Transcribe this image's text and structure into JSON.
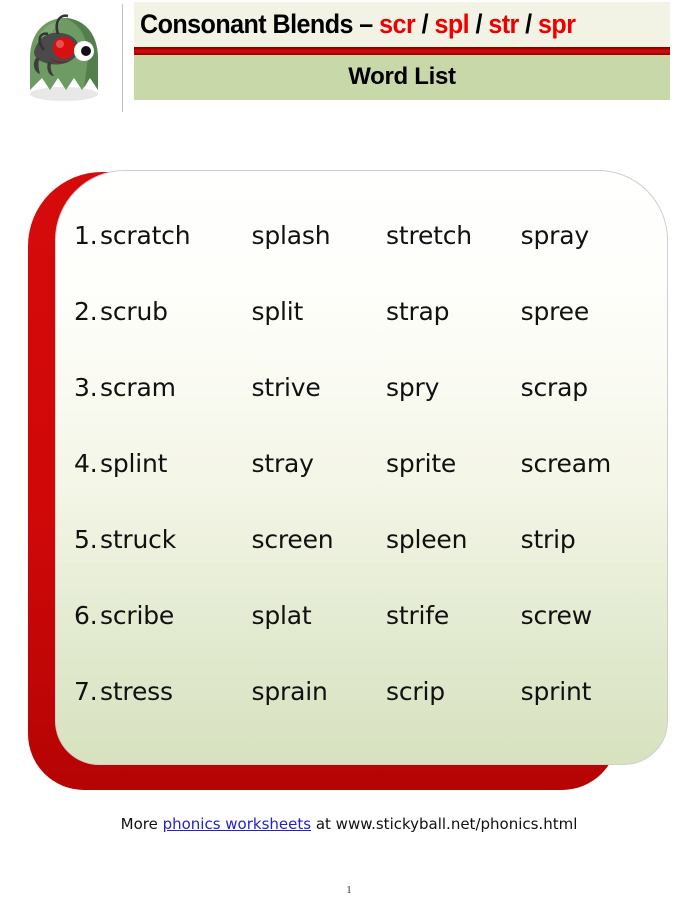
{
  "header": {
    "mascot_icon": "green-ghost-mascot-icon",
    "title_prefix": "Consonant Blends ",
    "title_dash": "– ",
    "blends": [
      "scr",
      "spl",
      "str",
      "spr"
    ],
    "blend_separator": "/",
    "subtitle": "Word List",
    "colors": {
      "title_band_bg": "#f2f3e4",
      "subtitle_band_bg": "#c8d8a8",
      "divider_red": "#d80c0c",
      "blend_text": "#ee0000"
    }
  },
  "word_list": {
    "columns": 4,
    "rows": [
      {
        "number": "1.",
        "words": [
          "scratch",
          "splash",
          "stretch",
          "spray"
        ]
      },
      {
        "number": "2.",
        "words": [
          "scrub",
          "split",
          "strap",
          "spree"
        ]
      },
      {
        "number": "3.",
        "words": [
          "scram",
          "strive",
          "spry",
          "scrap"
        ]
      },
      {
        "number": "4.",
        "words": [
          "splint",
          "stray",
          "sprite",
          "scream"
        ]
      },
      {
        "number": "5.",
        "words": [
          "struck",
          "screen",
          "spleen",
          "strip"
        ]
      },
      {
        "number": "6.",
        "words": [
          "scribe",
          "splat",
          "strife",
          "screw"
        ]
      },
      {
        "number": "7.",
        "words": [
          "stress",
          "sprain",
          "scrip",
          "sprint"
        ]
      }
    ],
    "panel_shadow_color": "#d60a0a"
  },
  "footer": {
    "prefix": "More ",
    "link_text": "phonics worksheets",
    "suffix": " at www.stickyball.net/phonics.html",
    "page_number": "1"
  }
}
